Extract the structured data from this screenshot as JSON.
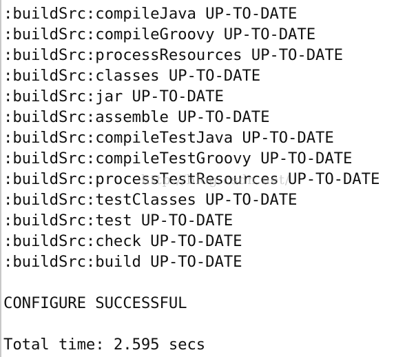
{
  "terminal": {
    "lines": [
      ":buildSrc:compileJava UP-TO-DATE",
      ":buildSrc:compileGroovy UP-TO-DATE",
      ":buildSrc:processResources UP-TO-DATE",
      ":buildSrc:classes UP-TO-DATE",
      ":buildSrc:jar UP-TO-DATE",
      ":buildSrc:assemble UP-TO-DATE",
      ":buildSrc:compileTestJava UP-TO-DATE",
      ":buildSrc:compileTestGroovy UP-TO-DATE",
      ":buildSrc:processTestResources UP-TO-DATE",
      ":buildSrc:testClasses UP-TO-DATE",
      ":buildSrc:test UP-TO-DATE",
      ":buildSrc:check UP-TO-DATE",
      ":buildSrc:build UP-TO-DATE",
      "",
      "CONFIGURE SUCCESSFUL",
      "",
      "Total time: 2.595 secs"
    ]
  },
  "watermark": "http://blog.csdn.net/"
}
